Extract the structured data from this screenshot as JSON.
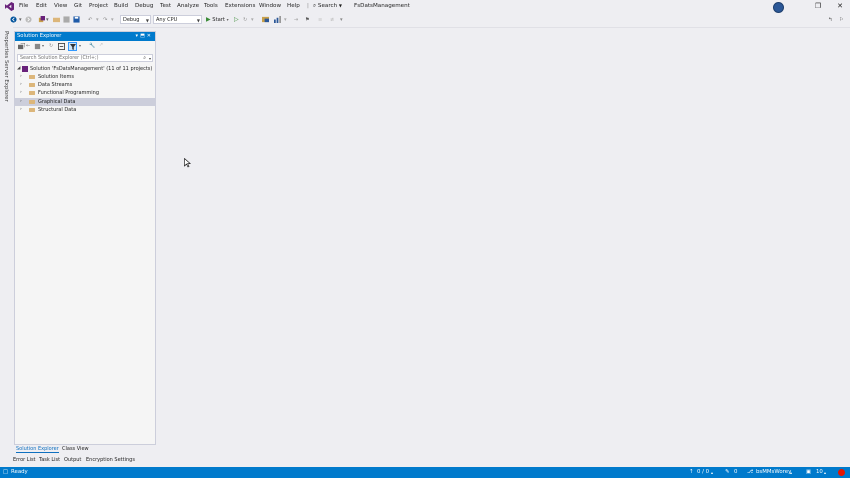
{
  "menubar": {
    "items": [
      "File",
      "Edit",
      "View",
      "Git",
      "Project",
      "Build",
      "Debug",
      "Test",
      "Analyze",
      "Tools",
      "Extensions",
      "Window",
      "Help"
    ],
    "search_label": "Search",
    "app_title": "FsDatsManagement",
    "icons": [
      "vs-logo-icon",
      "account-avatar-icon",
      "restore-icon",
      "close-icon"
    ]
  },
  "toolbar": {
    "config_value": "Debug",
    "platform_value": "Any CPU",
    "start_label": "Start"
  },
  "side_tabs": [
    "Properties",
    "Server Explorer"
  ],
  "solution_explorer": {
    "title": "Solution Explorer",
    "search_placeholder": "Search Solution Explorer (Ctrl+;)",
    "tree": [
      {
        "label": "Solution 'FsDatsManagement' (11 of 11 projects)",
        "level": 0,
        "expanded": true,
        "type": "solution",
        "selected": false
      },
      {
        "label": "Solution Items",
        "level": 1,
        "expanded": false,
        "type": "folder",
        "selected": false
      },
      {
        "label": "Data Streams",
        "level": 1,
        "expanded": false,
        "type": "folder",
        "selected": false
      },
      {
        "label": "Functional Programming",
        "level": 1,
        "expanded": false,
        "type": "folder",
        "selected": false
      },
      {
        "label": "Graphical Data",
        "level": 1,
        "expanded": false,
        "type": "folder",
        "selected": true
      },
      {
        "label": "Structural Data",
        "level": 1,
        "expanded": false,
        "type": "folder",
        "selected": false
      }
    ],
    "bottom_tabs": [
      "Solution Explorer",
      "Class View"
    ],
    "active_bottom_tab": "Solution Explorer"
  },
  "dock_tabs": [
    "Error List",
    "Task List",
    "Output",
    "Encryption Settings"
  ],
  "statusbar": {
    "status": "Ready",
    "line_col": "0 / 0",
    "edits": "0",
    "branch": "bsMMsWorey",
    "repo_count": "10",
    "colors": {
      "bar": "#007acc",
      "error": "#e51400"
    }
  }
}
